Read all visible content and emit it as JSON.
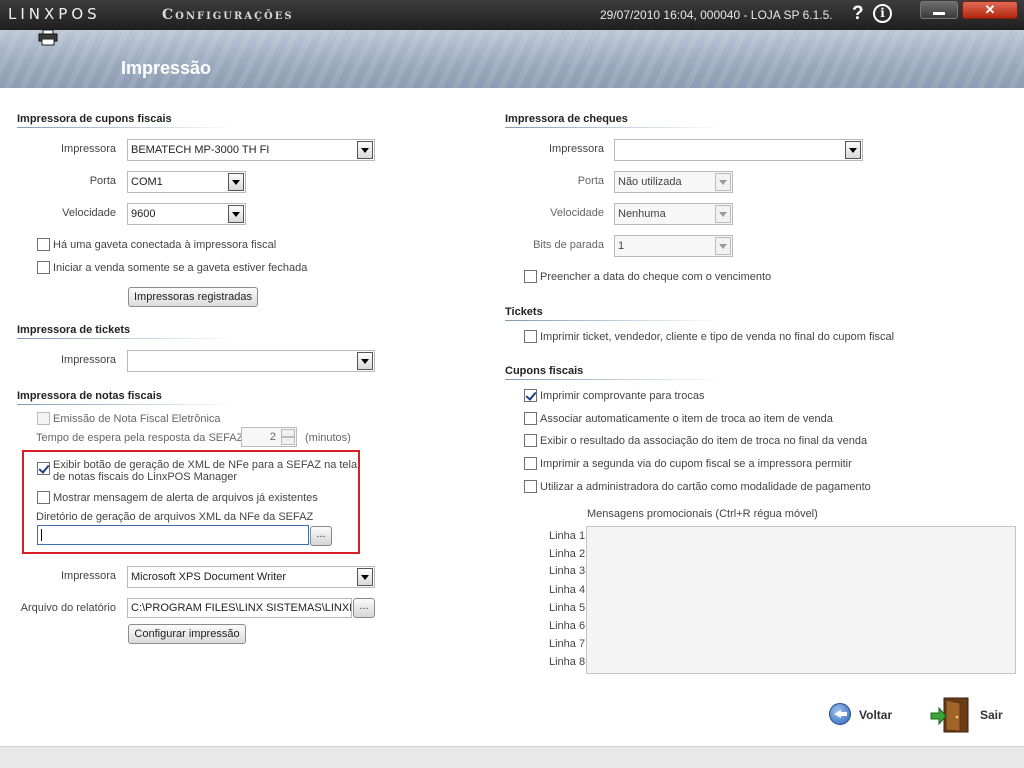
{
  "titlebar": {
    "logo": "LINXPOS",
    "app_title": "Configurações",
    "status": "29/07/2010 16:04, 000040 - LOJA SP 6.1.5.",
    "help_glyph": "?",
    "info_glyph": "i",
    "close_glyph": "✕"
  },
  "header": {
    "title": "Impressão",
    "icon": "printer-icon"
  },
  "fiscal_printer": {
    "heading": "Impressora de cupons fiscais",
    "printer_label": "Impressora",
    "printer_value": "BEMATECH MP-3000 TH FI",
    "port_label": "Porta",
    "port_value": "COM1",
    "speed_label": "Velocidade",
    "speed_value": "9600",
    "drawer_label": "Há uma gaveta conectada à impressora fiscal",
    "drawer_checked": false,
    "closed_drawer_label": "Iniciar a venda somente se a gaveta estiver fechada",
    "closed_drawer_checked": false,
    "registered_button": "Impressoras registradas"
  },
  "ticket_printer": {
    "heading": "Impressora de tickets",
    "printer_label": "Impressora",
    "printer_value": ""
  },
  "invoice_printer": {
    "heading": "Impressora de notas fiscais",
    "nfe_label": "Emissão de Nota Fiscal Eletrônica",
    "nfe_checked": false,
    "wait_label": "Tempo de espera pela resposta da SEFAZ",
    "wait_value": "2",
    "wait_unit": "(minutos)",
    "xml_button_label_line1": "Exibir botão de geração de XML de NFe para a SEFAZ na tela",
    "xml_button_label_line2": "de notas fiscais do LinxPOS Manager",
    "xml_button_checked": true,
    "alert_label": "Mostrar mensagem de alerta de arquivos já existentes",
    "alert_checked": false,
    "dir_label": "Diretório de geração de arquivos XML da NFe da SEFAZ",
    "dir_value": "",
    "browse_label": "...",
    "printer_label": "Impressora",
    "printer_value": "Microsoft XPS Document Writer",
    "report_label": "Arquivo do relatório",
    "report_value": "C:\\PROGRAM FILES\\LINX SISTEMAS\\LINXPOS",
    "configure_button": "Configurar impressão"
  },
  "cheque_printer": {
    "heading": "Impressora de cheques",
    "printer_label": "Impressora",
    "printer_value": "",
    "port_label": "Porta",
    "port_value": "Não utilizada",
    "speed_label": "Velocidade",
    "speed_value": "Nenhuma",
    "stopbits_label": "Bits de parada",
    "stopbits_value": "1",
    "fill_date_label": "Preencher a data do cheque com o vencimento",
    "fill_date_checked": false
  },
  "tickets": {
    "heading": "Tickets",
    "print_label": "Imprimir ticket, vendedor, cliente e tipo de venda  no final do cupom fiscal",
    "print_checked": false
  },
  "receipts": {
    "heading": "Cupons fiscais",
    "options": [
      {
        "label": "Imprimir comprovante para trocas",
        "checked": true
      },
      {
        "label": "Associar automaticamente o item de troca ao item de venda",
        "checked": false
      },
      {
        "label": "Exibir o resultado da associação do item de troca no final da venda",
        "checked": false
      },
      {
        "label": "Imprimir a segunda via do cupom fiscal se a impressora permitir",
        "checked": false
      },
      {
        "label": "Utilizar a administradora do cartão como modalidade de pagamento",
        "checked": false
      }
    ],
    "promo_title": "Mensagens promocionais (Ctrl+R régua móvel)",
    "lines": [
      "Linha 1",
      "Linha 2",
      "Linha 3",
      "Linha 4",
      "Linha 5",
      "Linha 6",
      "Linha 7",
      "Linha 8"
    ]
  },
  "footer": {
    "back_label": "Voltar",
    "exit_label": "Sair"
  },
  "colors": {
    "highlight": "#d81e26",
    "header": "#9aa9bd",
    "titlebar": "#2a2a2a"
  }
}
